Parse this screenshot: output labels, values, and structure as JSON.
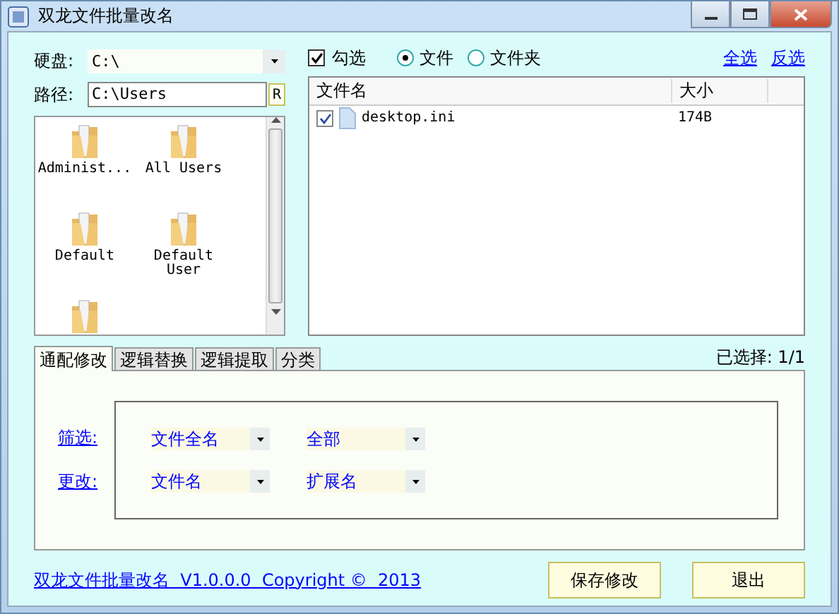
{
  "window": {
    "title": "双龙文件批量改名"
  },
  "drive": {
    "label": "硬盘:",
    "value": "C:\\"
  },
  "path": {
    "label": "路径:",
    "value": "C:\\Users",
    "button": "R"
  },
  "folders": [
    {
      "kind": "folder",
      "name": "Administ..."
    },
    {
      "kind": "folder",
      "name": "All Users"
    },
    {
      "kind": "folder",
      "name": "Default"
    },
    {
      "kind": "folder",
      "name": "Default User"
    },
    {
      "kind": "folder"
    }
  ],
  "check_select": {
    "label": "勾选",
    "checked": true
  },
  "type_radios": [
    {
      "label": "文件",
      "selected": true
    },
    {
      "label": "文件夹",
      "selected": false
    }
  ],
  "select_links": [
    "全选",
    "反选"
  ],
  "file_list": {
    "columns": [
      "文件名",
      "大小"
    ],
    "rows": [
      {
        "name": "desktop.ini",
        "size": "174B",
        "checked": true
      }
    ]
  },
  "tabs": [
    {
      "label": "通配修改",
      "selected": true
    },
    {
      "label": "逻辑替换",
      "selected": false
    },
    {
      "label": "逻辑提取",
      "selected": false
    },
    {
      "label": "分类",
      "selected": false
    }
  ],
  "selection_count": "已选择: 1/1",
  "rules": [
    {
      "label": "筛选:",
      "fields": [
        "文件全名",
        "全部"
      ]
    },
    {
      "label": "更改:",
      "fields": [
        "文件名",
        "扩展名"
      ]
    }
  ],
  "footer_link": "双龙文件批量改名  V1.0.0.0  Copyright ©  2013",
  "buttons": [
    "保存修改",
    "退出"
  ]
}
